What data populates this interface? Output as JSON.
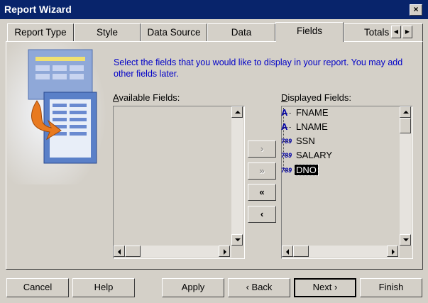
{
  "window": {
    "title": "Report Wizard",
    "close": "×"
  },
  "tabs": [
    "Report Type",
    "Style",
    "Data Source",
    "Data",
    "Fields",
    "Totals"
  ],
  "active_tab": "Fields",
  "instruction": "Select the fields that you would like to display in your report. You may add other fields later.",
  "available": {
    "label_key": "A",
    "label_rest": "vailable Fields:",
    "items": []
  },
  "displayed": {
    "label_key": "D",
    "label_rest": "isplayed Fields:",
    "items": [
      {
        "name": "FNAME",
        "icon": "text-field-icon",
        "glyph": "A"
      },
      {
        "name": "LNAME",
        "icon": "text-field-icon",
        "glyph": "A"
      },
      {
        "name": "SSN",
        "icon": "number-field-icon",
        "glyph": "789"
      },
      {
        "name": "SALARY",
        "icon": "number-field-icon",
        "glyph": "789"
      },
      {
        "name": "DNO",
        "icon": "number-field-icon",
        "glyph": "789",
        "selected": true
      }
    ]
  },
  "move": {
    "add_one": "›",
    "add_all": "»",
    "remove_all": "«",
    "remove_one": "‹"
  },
  "buttons": {
    "cancel": "Cancel",
    "help": "Help",
    "apply": "Apply",
    "back": "‹ Back",
    "next": "Next ›",
    "finish": "Finish"
  },
  "colors": {
    "titlebar": "#08246b",
    "face": "#d4d0c8",
    "instruction": "#0000c8",
    "selection": "#000000"
  }
}
